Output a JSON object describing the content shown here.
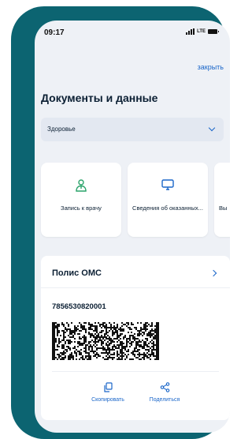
{
  "status_bar": {
    "time": "09:17",
    "network": "LTE"
  },
  "close_link": "закрыть",
  "page_title": "Документы и данные",
  "category_select": {
    "selected": "Здоровье"
  },
  "cards": [
    {
      "icon": "doctor-icon",
      "label": "Запись к врачу"
    },
    {
      "icon": "monitor-icon",
      "label": "Сведения об оказанных..."
    },
    {
      "icon": "unknown",
      "label": "Вы"
    }
  ],
  "polis": {
    "title": "Полис ОМС",
    "number": "7856530820001",
    "actions": {
      "copy_label": "Скопировать",
      "share_label": "Поделиться"
    }
  },
  "colors": {
    "frame": "#0c6471",
    "accent": "#1a66c9",
    "doctor_icon": "#2aa36a",
    "screen_bg": "#eef1f6"
  }
}
